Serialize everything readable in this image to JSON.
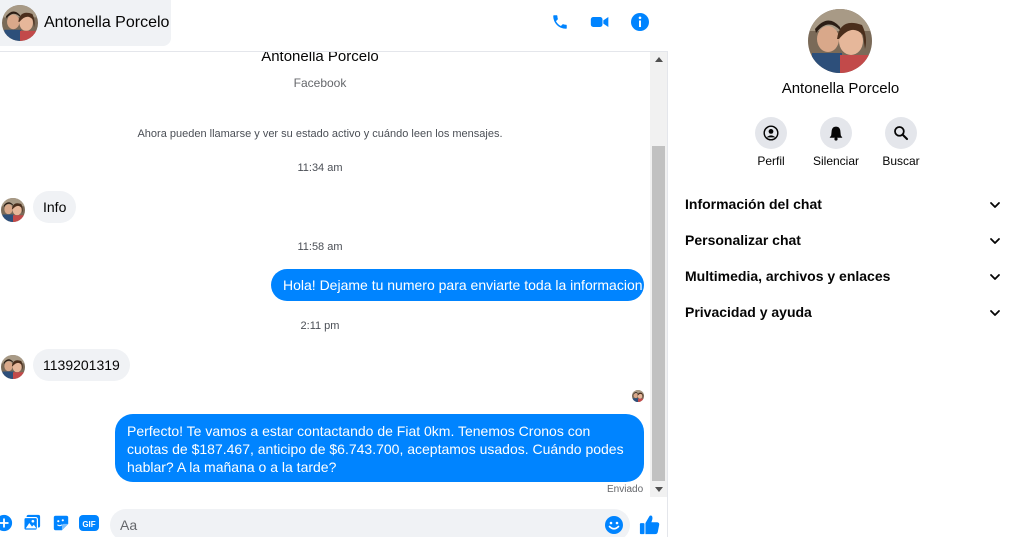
{
  "header": {
    "contact_name": "Antonella Porcelo",
    "icons": [
      "phone-icon",
      "video-camera-icon",
      "info-icon"
    ]
  },
  "thread": {
    "top_name": "Antonella Porcelo",
    "platform": "Facebook",
    "notice": "Ahora pueden llamarse y ver su estado activo y cuándo leen los mensajes.",
    "items": [
      {
        "type": "time",
        "text": "11:34 am"
      },
      {
        "type": "incoming",
        "text": "Info"
      },
      {
        "type": "time",
        "text": "11:58 am"
      },
      {
        "type": "outgoing",
        "text": "Hola! Dejame tu numero  para enviarte toda la informacion"
      },
      {
        "type": "time",
        "text": "2:11 pm"
      },
      {
        "type": "incoming",
        "text": "1139201319"
      },
      {
        "type": "outgoing",
        "text": "Perfecto! Te vamos a estar contactando de Fiat 0km. Tenemos Cronos con cuotas de $187.467, anticipo de $6.743.700, aceptamos usados. Cuándo podes hablar? A la mañana o a la tarde?"
      }
    ],
    "status": "Enviado"
  },
  "composer": {
    "placeholder": "Aa",
    "value": "",
    "icons": [
      "plus-icon",
      "photo-icon",
      "sticker-icon",
      "gif-icon",
      "emoji-icon",
      "thumbs-up-icon"
    ],
    "gif_label": "GIF"
  },
  "info_panel": {
    "name": "Antonella Porcelo",
    "actions": [
      {
        "label": "Perfil",
        "icon": "profile-icon"
      },
      {
        "label": "Silenciar",
        "icon": "bell-icon"
      },
      {
        "label": "Buscar",
        "icon": "search-icon"
      }
    ],
    "sections": [
      {
        "label": "Información del chat"
      },
      {
        "label": "Personalizar chat"
      },
      {
        "label": "Multimedia, archivos y enlaces"
      },
      {
        "label": "Privacidad y ayuda"
      }
    ]
  },
  "colors": {
    "accent": "#0084ff",
    "bubble_in": "#f0f2f5",
    "icon_blue": "#0084ff",
    "muted_text": "#65676b"
  }
}
